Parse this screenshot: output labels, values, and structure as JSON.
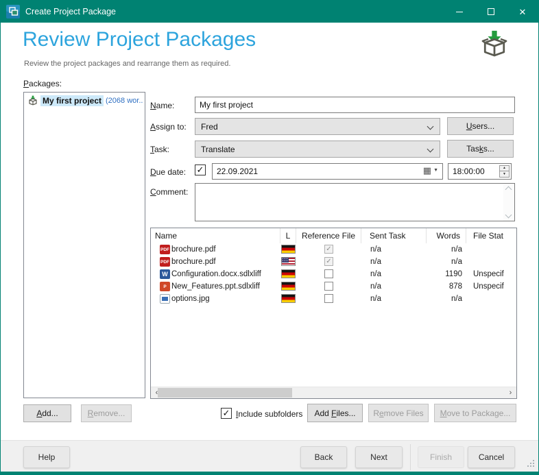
{
  "window": {
    "title": "Create Project Package"
  },
  "header": {
    "title": "Review Project Packages",
    "subtitle": "Review the project packages and  rearrange them as required."
  },
  "packages": {
    "label": {
      "pre": "",
      "key": "P",
      "post": "ackages:"
    },
    "selected_item": {
      "name": "My first project",
      "meta": "(2068 wor..."
    }
  },
  "form": {
    "name": {
      "label": {
        "pre": "",
        "key": "N",
        "post": "ame:"
      },
      "value": "My first project"
    },
    "assign_to": {
      "label": {
        "pre": "",
        "key": "A",
        "post": "ssign to:"
      },
      "value": "Fred",
      "button": {
        "pre": "",
        "key": "U",
        "post": "sers..."
      }
    },
    "task": {
      "label": {
        "pre": "",
        "key": "T",
        "post": "ask:"
      },
      "value": "Translate",
      "button": {
        "pre": "Tas",
        "key": "k",
        "post": "s..."
      }
    },
    "due_date": {
      "label": {
        "pre": "",
        "key": "D",
        "post": "ue date:"
      },
      "checked": true,
      "date": "22.09.2021",
      "time": "18:00:00"
    },
    "comment": {
      "label": {
        "pre": "",
        "key": "C",
        "post": "omment:"
      },
      "value": ""
    }
  },
  "files_table": {
    "columns": [
      "Name",
      "L",
      "Reference File",
      "Sent Task",
      "Words",
      "File Stat"
    ],
    "rows": [
      {
        "name": "brochure.pdf",
        "file_type": "pdf",
        "flag": "de",
        "reference_checked": true,
        "sent_task": "n/a",
        "words": "n/a",
        "file_status": ""
      },
      {
        "name": "brochure.pdf",
        "file_type": "pdf",
        "flag": "us",
        "reference_checked": true,
        "sent_task": "n/a",
        "words": "n/a",
        "file_status": ""
      },
      {
        "name": "Configuration.docx.sdlxliff",
        "file_type": "word",
        "flag": "de",
        "reference_checked": false,
        "sent_task": "n/a",
        "words": "1190",
        "file_status": "Unspecif"
      },
      {
        "name": "New_Features.ppt.sdlxliff",
        "file_type": "ppt",
        "flag": "de",
        "reference_checked": false,
        "sent_task": "n/a",
        "words": "878",
        "file_status": "Unspecif"
      },
      {
        "name": "options.jpg",
        "file_type": "image",
        "flag": "de",
        "reference_checked": false,
        "sent_task": "n/a",
        "words": "n/a",
        "file_status": ""
      }
    ]
  },
  "actions": {
    "add": {
      "pre": "",
      "key": "A",
      "post": "dd..."
    },
    "remove": {
      "pre": "",
      "key": "R",
      "post": "emove..."
    },
    "include_subfolders": {
      "pre": "",
      "key": "I",
      "post": "nclude subfolders",
      "checked": true
    },
    "add_files": {
      "pre": "Add ",
      "key": "F",
      "post": "iles..."
    },
    "remove_files": {
      "pre": "R",
      "key": "e",
      "post": "move Files"
    },
    "move_to_package": {
      "pre": "",
      "key": "M",
      "post": "ove to Package..."
    }
  },
  "footer": {
    "help": "Help",
    "back": "Back",
    "next": "Next",
    "finish": "Finish",
    "cancel": "Cancel"
  },
  "colors": {
    "titlebar": "#008272",
    "heading": "#2da4dd",
    "selection": "#cde9f9"
  }
}
